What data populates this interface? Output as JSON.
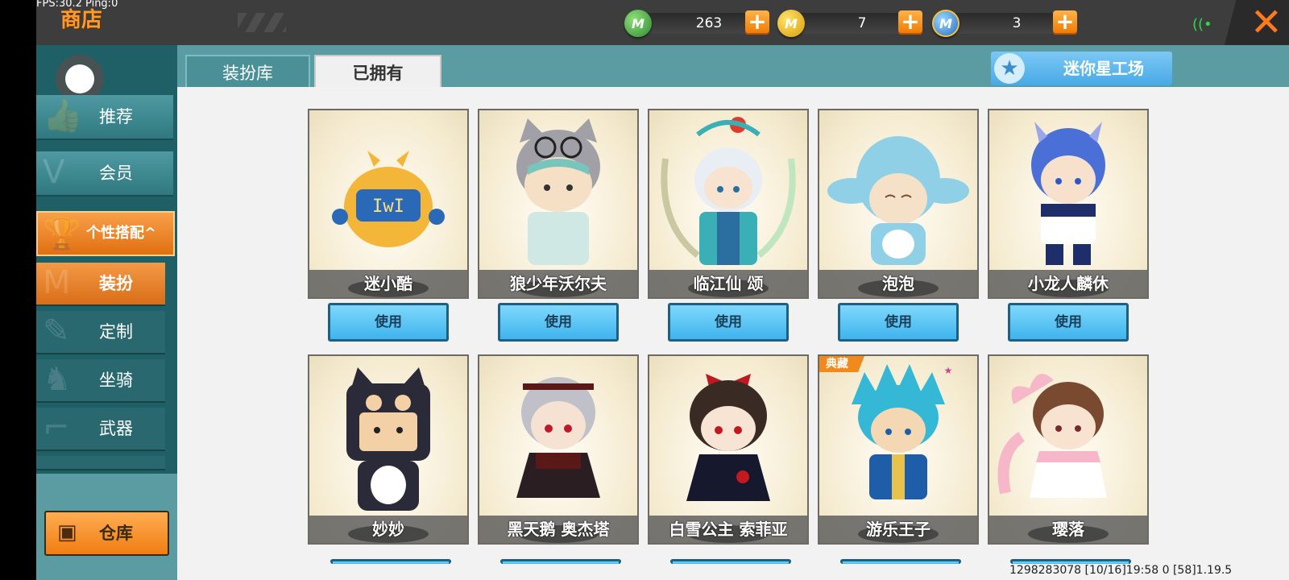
{
  "debug": {
    "fps_text": "FPS:30.2  Ping:0"
  },
  "header": {
    "title": "商店",
    "close_glyph": "✕",
    "currencies": [
      {
        "name": "green-gem",
        "value": "263",
        "color": "#3aa83c",
        "glyph": "M"
      },
      {
        "name": "gold-coin",
        "value": "7",
        "color": "#f2b81a",
        "glyph": "M"
      },
      {
        "name": "blue-coin",
        "value": "3",
        "color": "#3a8de0",
        "glyph": "M"
      }
    ],
    "plus_glyph": "+"
  },
  "sidebar": {
    "items": [
      {
        "label": "推荐",
        "icon": "thumbs-up-icon"
      },
      {
        "label": "会员",
        "icon": "vip-icon"
      }
    ],
    "group": {
      "label": "个性搭配",
      "icon": "trophy-icon",
      "arrow": "^"
    },
    "sub_items": [
      {
        "label": "装扮",
        "icon": "shirt-icon",
        "active": true
      },
      {
        "label": "定制",
        "icon": "pencil-icon",
        "active": false
      },
      {
        "label": "坐骑",
        "icon": "mount-icon",
        "active": false
      },
      {
        "label": "武器",
        "icon": "gun-icon",
        "active": false
      }
    ],
    "warehouse": {
      "label": "仓库",
      "icon": "chest-icon"
    }
  },
  "tabs": [
    {
      "label": "装扮库",
      "active": false
    },
    {
      "label": "已拥有",
      "active": true
    }
  ],
  "workshop": {
    "label": "迷你星工场",
    "icon": "star-icon"
  },
  "skins_row1": [
    {
      "name": "迷小酷",
      "button": "使用",
      "palette": [
        "#f4b638",
        "#2a68b8",
        "#ffe07a"
      ]
    },
    {
      "name": "狼少年沃尔夫",
      "button": "使用",
      "palette": [
        "#a0a0a6",
        "#cfe8e4",
        "#79c5bd"
      ]
    },
    {
      "name": "临江仙 颂",
      "button": "使用",
      "palette": [
        "#e8eef4",
        "#3ab0b6",
        "#2a6fa0"
      ]
    },
    {
      "name": "泡泡",
      "button": "使用",
      "palette": [
        "#8fd0e6",
        "#f5e0c8",
        "#ffffff"
      ]
    },
    {
      "name": "小龙人麟休",
      "button": "使用",
      "palette": [
        "#4a6fd6",
        "#ffffff",
        "#1e2e6a"
      ]
    }
  ],
  "skins_row2": [
    {
      "name": "妙妙",
      "badge": "",
      "palette": [
        "#2a2a38",
        "#f4d0a6",
        "#ffffff"
      ]
    },
    {
      "name": "黑天鹅 奥杰塔",
      "badge": "",
      "palette": [
        "#c0c0c8",
        "#5a1818",
        "#2a1e22"
      ]
    },
    {
      "name": "白雪公主 索菲亚",
      "badge": "",
      "palette": [
        "#3a2a24",
        "#c01a20",
        "#16182e"
      ]
    },
    {
      "name": "游乐王子",
      "badge": "典藏",
      "palette": [
        "#34b8d6",
        "#1e5ea8",
        "#f4d8b4"
      ]
    },
    {
      "name": "璎落",
      "badge": "",
      "palette": [
        "#f6b8c8",
        "#7a4a30",
        "#ffffff"
      ]
    }
  ],
  "footer": {
    "info": "1298283078   [10/16]19:58 0    [58]1.19.5"
  }
}
